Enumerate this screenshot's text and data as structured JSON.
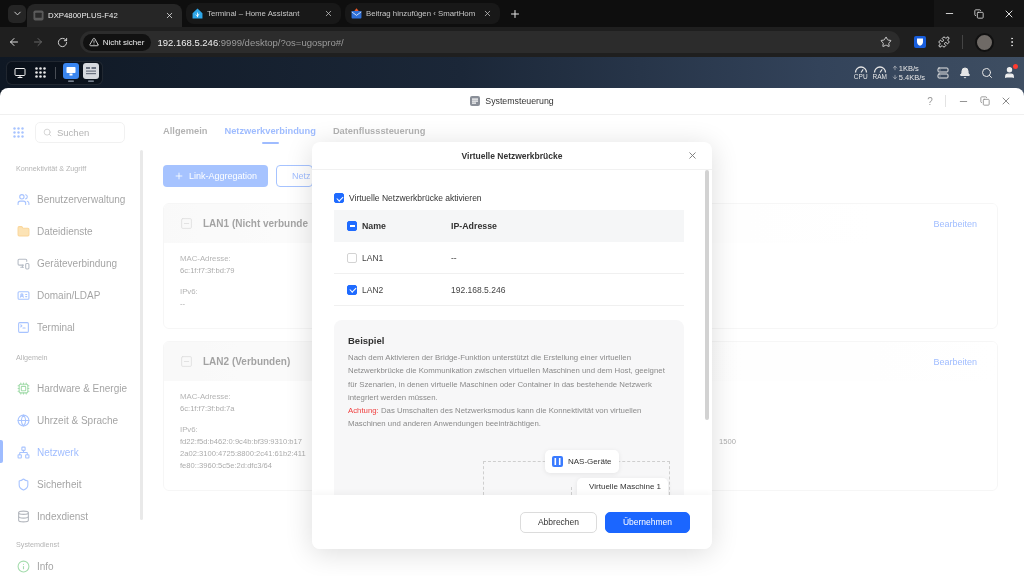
{
  "browser": {
    "tabs": [
      {
        "title": "DXP4800PLUS-F42",
        "selected": true
      },
      {
        "title": "Terminal – Home Assistant",
        "selected": false
      },
      {
        "title": "Beitrag hinzufügen ‹ SmartHom",
        "selected": false
      }
    ],
    "address_bar": {
      "security_label": "Nicht sicher",
      "host": "192.168.5.246",
      "path": ":9999/desktop/?os=ugospro#/"
    }
  },
  "taskbar": {
    "cpu_label": "CPU",
    "ram_label": "RAM",
    "upload": "1KB/s",
    "download": "5.4KB/s",
    "notification_dot": true
  },
  "window": {
    "title": "Systemsteuerung",
    "help": "?"
  },
  "sidebar": {
    "search": {
      "placeholder": "Suchen"
    },
    "sections": [
      {
        "title": "Konnektivität & Zugriff",
        "items": [
          {
            "label": "Benutzerverwaltung",
            "selected": false
          },
          {
            "label": "Dateidienste",
            "selected": false
          },
          {
            "label": "Geräteverbindung",
            "selected": false
          },
          {
            "label": "Domain/LDAP",
            "selected": false
          },
          {
            "label": "Terminal",
            "selected": false
          }
        ]
      },
      {
        "title": "Allgemein",
        "items": [
          {
            "label": "Hardware & Energie",
            "selected": false
          },
          {
            "label": "Uhrzeit & Sprache",
            "selected": false
          },
          {
            "label": "Netzwerk",
            "selected": true
          },
          {
            "label": "Sicherheit",
            "selected": false
          },
          {
            "label": "Indexdienst",
            "selected": false
          }
        ]
      },
      {
        "title": "Systemdienst",
        "items": [
          {
            "label": "Info",
            "selected": false
          }
        ]
      }
    ]
  },
  "tabs": [
    {
      "label": "Allgemein",
      "selected": false
    },
    {
      "label": "Netzwerkverbindung",
      "selected": true
    },
    {
      "label": "Datenflusssteuerung",
      "selected": false
    }
  ],
  "toolbar": [
    {
      "label": "Link-Aggregation",
      "kind": "primary"
    },
    {
      "label": "Netz",
      "kind": "outline"
    }
  ],
  "interfaces": [
    {
      "title": "LAN1 (Nicht verbunde",
      "expanded": true,
      "action": "Bearbeiten",
      "fields": [
        {
          "label": "MAC-Adresse:",
          "lines": [
            "6c:1f:f7:3f:bd:79"
          ]
        },
        {
          "label": "IPv6:",
          "lines": [
            "--"
          ]
        }
      ]
    },
    {
      "title": "LAN2 (Verbunden)",
      "expanded": true,
      "action": "Bearbeiten",
      "fields": [
        {
          "label": "MAC-Adresse:",
          "lines": [
            "6c:1f:f7:3f:bd:7a"
          ]
        },
        {
          "label": "IPv6:",
          "lines": [
            "fd22:f5d:b462:0:9c4b:bf39:9310:b17",
            "2a02:3100:4725:8800:2c41:61b2:411",
            "fe80::3960:5c5e:2d:dfc3/64"
          ]
        }
      ],
      "column_2": "1500"
    }
  ],
  "dialog": {
    "title": "Virtuelle Netzwerkbrücke",
    "enable": {
      "label": "Virtuelle Netzwerkbrücke aktivieren",
      "checked": true
    },
    "table": {
      "select_all": {
        "indeterminate": true
      },
      "columns": [
        "Name",
        "IP-Adresse"
      ],
      "rows": [
        {
          "name": "LAN1",
          "ip": "--",
          "checked": false
        },
        {
          "name": "LAN2",
          "ip": "192.168.5.246",
          "checked": true
        }
      ]
    },
    "example": {
      "title": "Beispiel",
      "text": "Nach dem Aktivieren der Bridge-Funktion unterstützt die Erstellung einer virtuellen Netzwerkbrücke die Kommunikation zwischen virtuellen Maschinen und dem Host, geeignet für Szenarien, in denen virtuelle Maschinen oder Container in das bestehende Netzwerk integriert werden müssen.",
      "warning_label": "Achtung:",
      "warning": "Das Umschalten des Netzwerksmodus kann die Konnektivität von virtuellen Maschinen und anderen Anwendungen beeinträchtigen."
    },
    "diagram": {
      "nodes": [
        {
          "label": "NAS-Geräte",
          "kind": "nas"
        },
        {
          "label": "Virtuelle Maschine 1",
          "kind": "vm"
        }
      ]
    },
    "buttons": [
      {
        "label": "Abbrechen",
        "kind": "secondary"
      },
      {
        "label": "Übernehmen",
        "kind": "primary"
      }
    ]
  }
}
